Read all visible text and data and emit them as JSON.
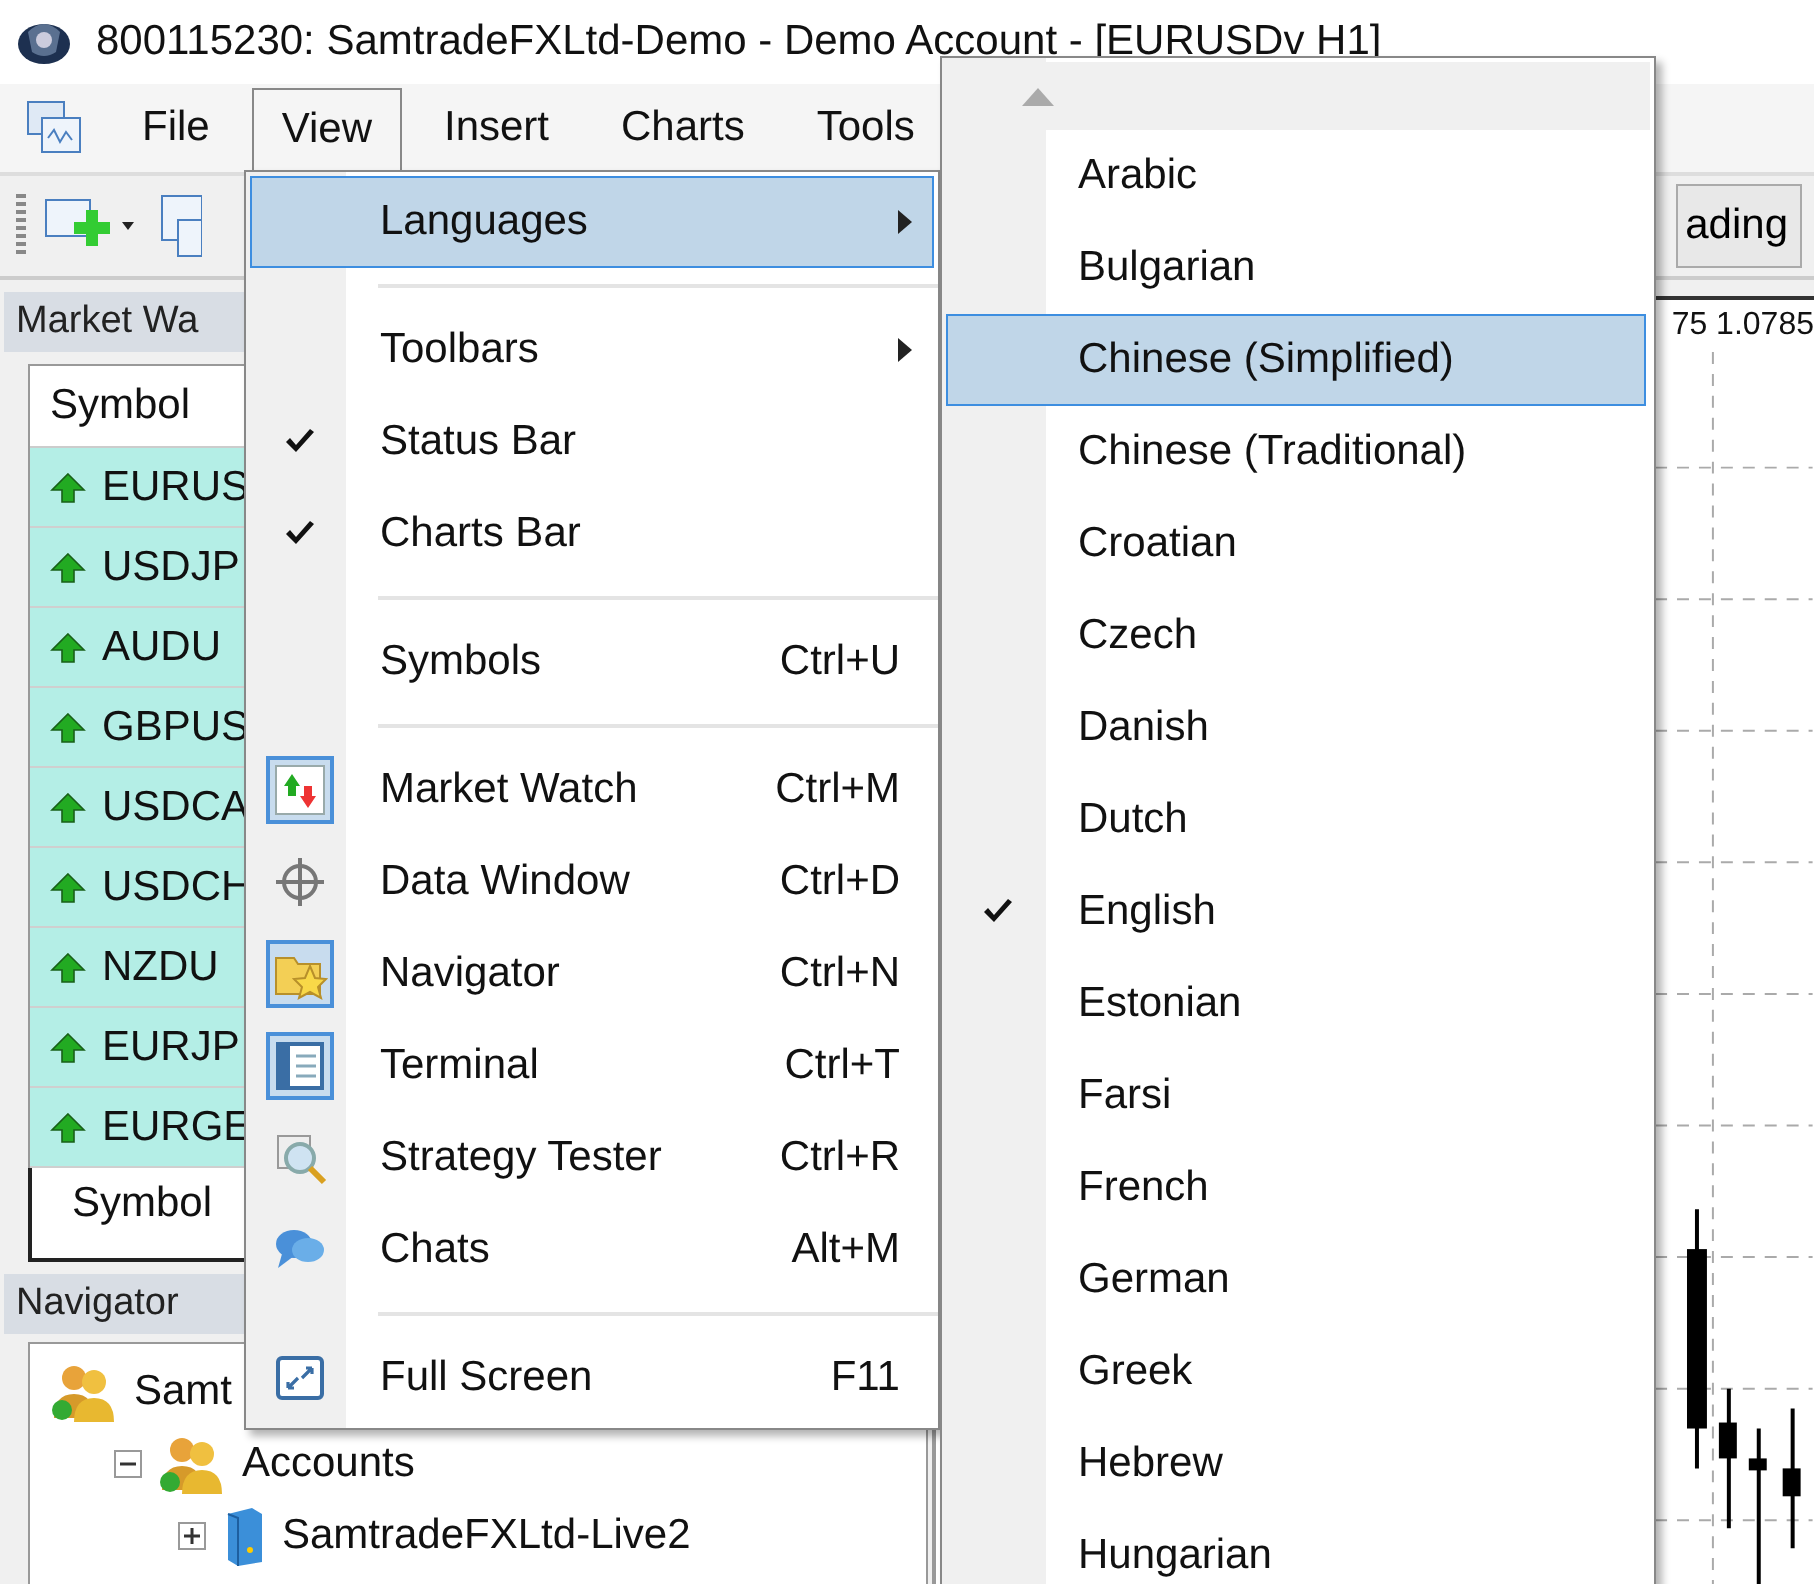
{
  "window": {
    "title": "800115230: SamtradeFXLtd-Demo - Demo Account - [EURUSDv H1]"
  },
  "menu_bar": {
    "items": [
      {
        "label": "File",
        "selected": false
      },
      {
        "label": "View",
        "selected": true
      },
      {
        "label": "Insert",
        "selected": false
      },
      {
        "label": "Charts",
        "selected": false
      },
      {
        "label": "Tools",
        "selected": false
      }
    ]
  },
  "toolbar": {
    "button_label": "ading"
  },
  "market_watch": {
    "title": "Market Wa",
    "column": "Symbol",
    "rows": [
      {
        "symbol": "EURUS"
      },
      {
        "symbol": "USDJP"
      },
      {
        "symbol": "AUDU"
      },
      {
        "symbol": "GBPUS"
      },
      {
        "symbol": "USDCA"
      },
      {
        "symbol": "USDCH"
      },
      {
        "symbol": "NZDU"
      },
      {
        "symbol": "EURJP"
      },
      {
        "symbol": "EURGE"
      }
    ],
    "tab": "Symbol"
  },
  "navigator": {
    "title": "Navigator",
    "tree": [
      {
        "label": "Samt",
        "children": [
          {
            "label": "Accounts",
            "expanded": true,
            "children": [
              {
                "label": "SamtradeFXLtd-Live2",
                "expanded": false
              }
            ]
          }
        ]
      }
    ]
  },
  "chart": {
    "price_label": "75 1.0785"
  },
  "view_menu": {
    "items": [
      {
        "kind": "item",
        "label": "Languages",
        "submenu": true,
        "checked": false,
        "selected": true
      },
      {
        "kind": "separator"
      },
      {
        "kind": "item",
        "label": "Toolbars",
        "submenu": true,
        "checked": false,
        "selected": false
      },
      {
        "kind": "item",
        "label": "Status Bar",
        "submenu": false,
        "checked": true,
        "selected": false
      },
      {
        "kind": "item",
        "label": "Charts Bar",
        "submenu": false,
        "checked": true,
        "selected": false
      },
      {
        "kind": "separator"
      },
      {
        "kind": "item",
        "label": "Symbols",
        "shortcut": "Ctrl+U",
        "submenu": false,
        "checked": false,
        "selected": false
      },
      {
        "kind": "separator"
      },
      {
        "kind": "item",
        "label": "Market Watch",
        "shortcut": "Ctrl+M",
        "submenu": false,
        "checked": true,
        "selected": false
      },
      {
        "kind": "item",
        "label": "Data Window",
        "shortcut": "Ctrl+D",
        "submenu": false,
        "checked": false,
        "selected": false
      },
      {
        "kind": "item",
        "label": "Navigator",
        "shortcut": "Ctrl+N",
        "submenu": false,
        "checked": true,
        "selected": false
      },
      {
        "kind": "item",
        "label": "Terminal",
        "shortcut": "Ctrl+T",
        "submenu": false,
        "checked": true,
        "selected": false
      },
      {
        "kind": "item",
        "label": "Strategy Tester",
        "shortcut": "Ctrl+R",
        "submenu": false,
        "checked": false,
        "selected": false
      },
      {
        "kind": "item",
        "label": "Chats",
        "shortcut": "Alt+M",
        "submenu": false,
        "checked": false,
        "selected": false
      },
      {
        "kind": "separator"
      },
      {
        "kind": "item",
        "label": "Full Screen",
        "shortcut": "F11",
        "submenu": false,
        "checked": false,
        "selected": false
      }
    ]
  },
  "languages_menu": {
    "items": [
      {
        "label": "Arabic",
        "checked": false,
        "selected": false
      },
      {
        "label": "Bulgarian",
        "checked": false,
        "selected": false
      },
      {
        "label": "Chinese (Simplified)",
        "checked": false,
        "selected": true
      },
      {
        "label": "Chinese (Traditional)",
        "checked": false,
        "selected": false
      },
      {
        "label": "Croatian",
        "checked": false,
        "selected": false
      },
      {
        "label": "Czech",
        "checked": false,
        "selected": false
      },
      {
        "label": "Danish",
        "checked": false,
        "selected": false
      },
      {
        "label": "Dutch",
        "checked": false,
        "selected": false
      },
      {
        "label": "English",
        "checked": true,
        "selected": false
      },
      {
        "label": "Estonian",
        "checked": false,
        "selected": false
      },
      {
        "label": "Farsi",
        "checked": false,
        "selected": false
      },
      {
        "label": "French",
        "checked": false,
        "selected": false
      },
      {
        "label": "German",
        "checked": false,
        "selected": false
      },
      {
        "label": "Greek",
        "checked": false,
        "selected": false
      },
      {
        "label": "Hebrew",
        "checked": false,
        "selected": false
      },
      {
        "label": "Hungarian",
        "checked": false,
        "selected": false
      }
    ]
  }
}
